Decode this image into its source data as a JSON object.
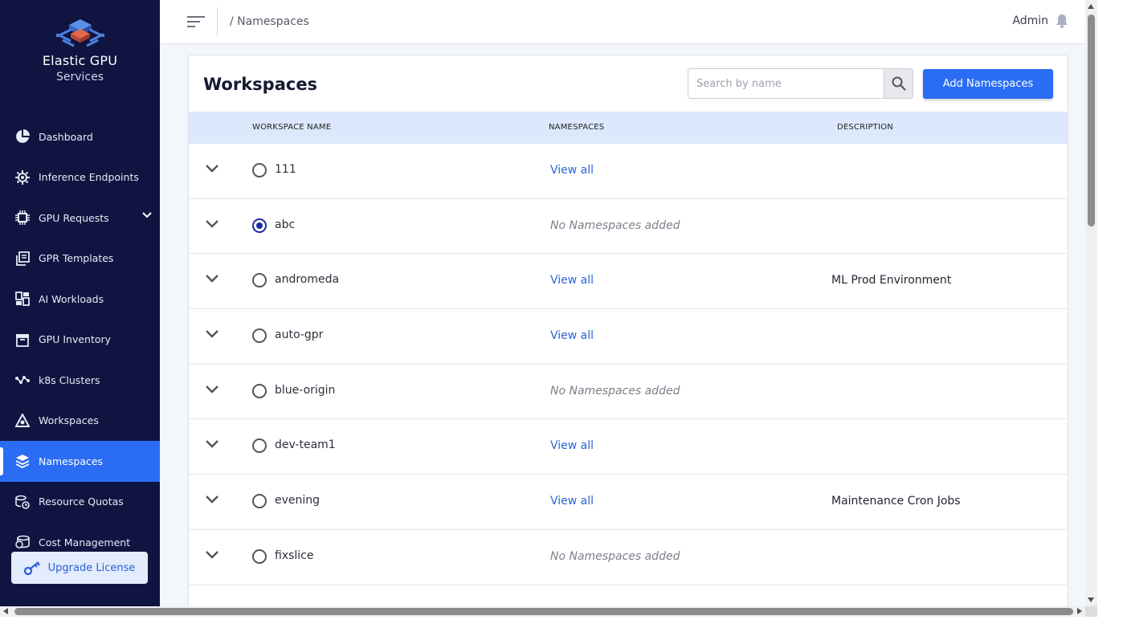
{
  "sidebar": {
    "brand_title": "Elastic GPU",
    "brand_sub": "Services",
    "items": [
      {
        "label": "Dashboard",
        "icon": "pie-chart-icon"
      },
      {
        "label": "Inference Endpoints",
        "icon": "gear-chip-icon"
      },
      {
        "label": "GPU Requests",
        "icon": "cpu-icon"
      },
      {
        "label": "GPR Templates",
        "icon": "copy-icon"
      },
      {
        "label": "AI Workloads",
        "icon": "grid-icon"
      },
      {
        "label": "GPU Inventory",
        "icon": "archive-icon"
      },
      {
        "label": "k8s Clusters",
        "icon": "nodes-icon"
      },
      {
        "label": "Workspaces",
        "icon": "workspace-icon"
      },
      {
        "label": "Namespaces",
        "icon": "layers-icon"
      },
      {
        "label": "Resource Quotas",
        "icon": "quota-icon"
      },
      {
        "label": "Cost Management",
        "icon": "coins-icon"
      }
    ],
    "active_item": "Namespaces",
    "upgrade_label": "Upgrade License"
  },
  "header": {
    "breadcrumb": "/ Namespaces",
    "user": "Admin"
  },
  "main": {
    "title": "Workspaces",
    "search_placeholder": "Search by name",
    "add_button": "Add Namespaces",
    "columns": {
      "workspace_name": "WORKSPACE NAME",
      "namespaces": "NAMESPACES",
      "description": "DESCRIPTION"
    },
    "rows": [
      {
        "name": "111",
        "namespaces": "View all",
        "has_ns": true,
        "description": "",
        "selected": false
      },
      {
        "name": "abc",
        "namespaces": "No Namespaces added",
        "has_ns": false,
        "description": "",
        "selected": true
      },
      {
        "name": "andromeda",
        "namespaces": "View all",
        "has_ns": true,
        "description": "ML Prod Environment",
        "selected": false
      },
      {
        "name": "auto-gpr",
        "namespaces": "View all",
        "has_ns": true,
        "description": "",
        "selected": false
      },
      {
        "name": "blue-origin",
        "namespaces": "No Namespaces added",
        "has_ns": false,
        "description": "",
        "selected": false
      },
      {
        "name": "dev-team1",
        "namespaces": "View all",
        "has_ns": true,
        "description": "",
        "selected": false
      },
      {
        "name": "evening",
        "namespaces": "View all",
        "has_ns": true,
        "description": "Maintenance Cron Jobs",
        "selected": false
      },
      {
        "name": "fixslice",
        "namespaces": "No Namespaces added",
        "has_ns": false,
        "description": "",
        "selected": false
      }
    ]
  },
  "colors": {
    "sidebar_bg": "#0f1540",
    "accent": "#2a6df4",
    "link": "#2a63d6",
    "table_header_bg": "#dce8fb"
  }
}
